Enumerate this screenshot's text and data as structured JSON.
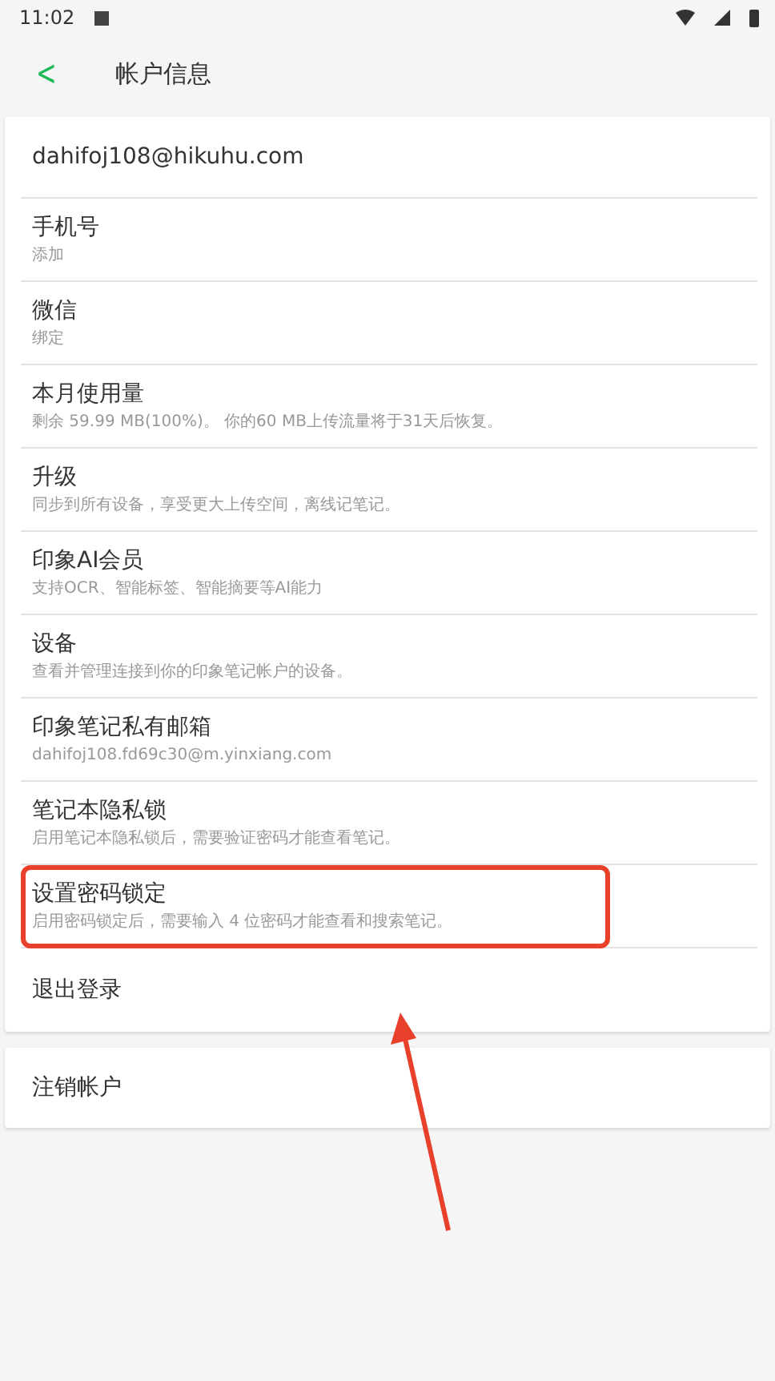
{
  "status_bar": {
    "time": "11:02"
  },
  "header": {
    "back": "<",
    "title": "帐户信息"
  },
  "account": {
    "email": "dahifoj108@hikuhu.com"
  },
  "items": [
    {
      "title": "手机号",
      "subtitle": "添加",
      "highlighted": false
    },
    {
      "title": "微信",
      "subtitle": "绑定",
      "highlighted": false
    },
    {
      "title": "本月使用量",
      "subtitle": "剩余 59.99 MB(100%)。 你的60 MB上传流量将于31天后恢复。",
      "highlighted": false
    },
    {
      "title": "升级",
      "subtitle": "同步到所有设备，享受更大上传空间，离线记笔记。",
      "highlighted": false
    },
    {
      "title": "印象AI会员",
      "subtitle": "支持OCR、智能标签、智能摘要等AI能力",
      "highlighted": false
    },
    {
      "title": "设备",
      "subtitle": "查看并管理连接到你的印象笔记帐户的设备。",
      "highlighted": false
    },
    {
      "title": "印象笔记私有邮箱",
      "subtitle": "dahifoj108.fd69c30@m.yinxiang.com",
      "highlighted": false
    },
    {
      "title": "笔记本隐私锁",
      "subtitle": "启用笔记本隐私锁后，需要验证密码才能查看笔记。",
      "highlighted": false
    },
    {
      "title": "设置密码锁定",
      "subtitle": "启用密码锁定后，需要输入 4 位密码才能查看和搜索笔记。",
      "highlighted": true
    },
    {
      "title": "退出登录",
      "highlighted": false
    }
  ],
  "delete_account": {
    "label": "注销帐户"
  },
  "annotation": {
    "arrow": true
  }
}
